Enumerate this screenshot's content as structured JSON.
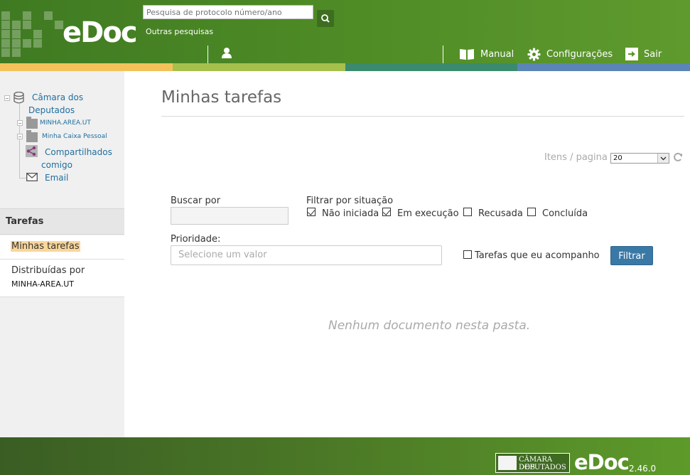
{
  "header": {
    "brand": "eDoc",
    "search_placeholder": "Pesquisa de protocolo número/ano",
    "other_searches": "Outras pesquisas",
    "nav": {
      "manual": "Manual",
      "settings": "Configurações",
      "logout": "Sair"
    },
    "strip_colors": [
      "#f4c25a",
      "#a6c04c",
      "#3b8a6e",
      "#5b85b5"
    ]
  },
  "sidebar": {
    "tree": {
      "root_line1": "Câmara dos",
      "root_line2": "Deputados",
      "area": "MINHA.AREA.UT",
      "personal_box": "Minha Caixa Pessoal",
      "shared_line1": "Compartilhados",
      "shared_line2": "comigo",
      "email": "Email"
    },
    "tasks_header": "Tarefas",
    "my_tasks": "Minhas tarefas",
    "distributed_label": "Distribuídas por",
    "distributed_area": "MINHA-AREA.UT"
  },
  "main": {
    "title": "Minhas tarefas",
    "items_per_page_label": "Itens / pagina",
    "items_per_page_value": "20",
    "search_by_label": "Buscar por",
    "filter_status_label": "Filtrar por situação",
    "statuses": [
      {
        "label": "Não iniciada",
        "checked": true
      },
      {
        "label": "Em execução",
        "checked": true
      },
      {
        "label": "Recusada",
        "checked": false
      },
      {
        "label": "Concluída",
        "checked": false
      }
    ],
    "priority_label": "Prioridade:",
    "priority_placeholder": "Selecione um valor",
    "follow_label": "Tarefas que eu acompanho",
    "follow_checked": false,
    "filter_button": "Filtrar",
    "empty_message": "Nenhum documento nesta pasta."
  },
  "footer": {
    "camara_line1": "CÂMARA DOS",
    "camara_line2": "DEPUTADOS",
    "brand": "eDoc",
    "version": "2.46.0"
  }
}
